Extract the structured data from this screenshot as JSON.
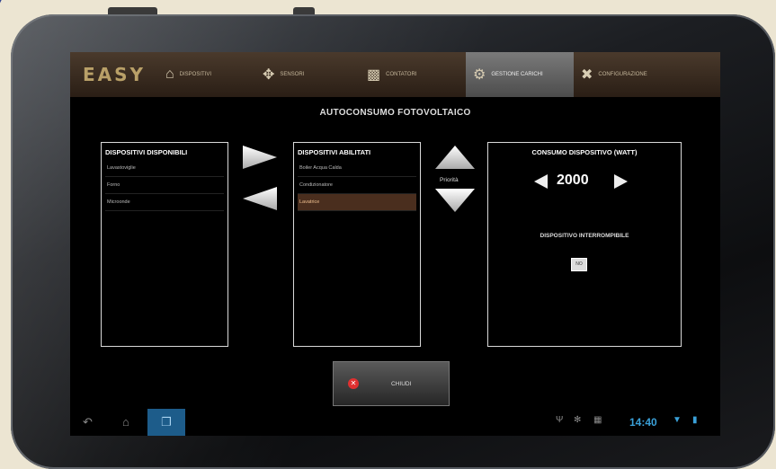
{
  "app": {
    "logo": "EASY"
  },
  "nav": [
    {
      "label": "DISPOSITIVI",
      "icon": "home-icon"
    },
    {
      "label": "SENSORI",
      "icon": "sensor-icon"
    },
    {
      "label": "CONTATORI",
      "icon": "bar-chart-icon"
    },
    {
      "label": "GESTIONE CARICHI",
      "icon": "plug-gear-icon",
      "active": true
    },
    {
      "label": "CONFIGURAZIONE",
      "icon": "tools-icon"
    }
  ],
  "page_title": "AUTOCONSUMO FOTOVOLTAICO",
  "available": {
    "title": "DISPOSITIVI DISPONIBILI",
    "items": [
      "Lavastoviglie",
      "Forno",
      "Microonde"
    ]
  },
  "enabled": {
    "title": "DISPOSITIVI ABILITATI",
    "items": [
      "Boiler Acqua Calda",
      "Condizionatore",
      "Lavatrice"
    ],
    "selected_index": 2
  },
  "priority_label": "Priorità",
  "consumption": {
    "title": "CONSUMO DISPOSITIVO (WATT)",
    "value": "2000",
    "interruptible_label": "DISPOSITIVO INTERROMPIBILE",
    "interruptible_value": "NO"
  },
  "close_label": "CHIUDI",
  "status_bar": {
    "clock": "14:40"
  },
  "colors": {
    "accent": "#3aa0d8",
    "selected_row": "#4a2e1e",
    "close_icon": "#e03030"
  }
}
